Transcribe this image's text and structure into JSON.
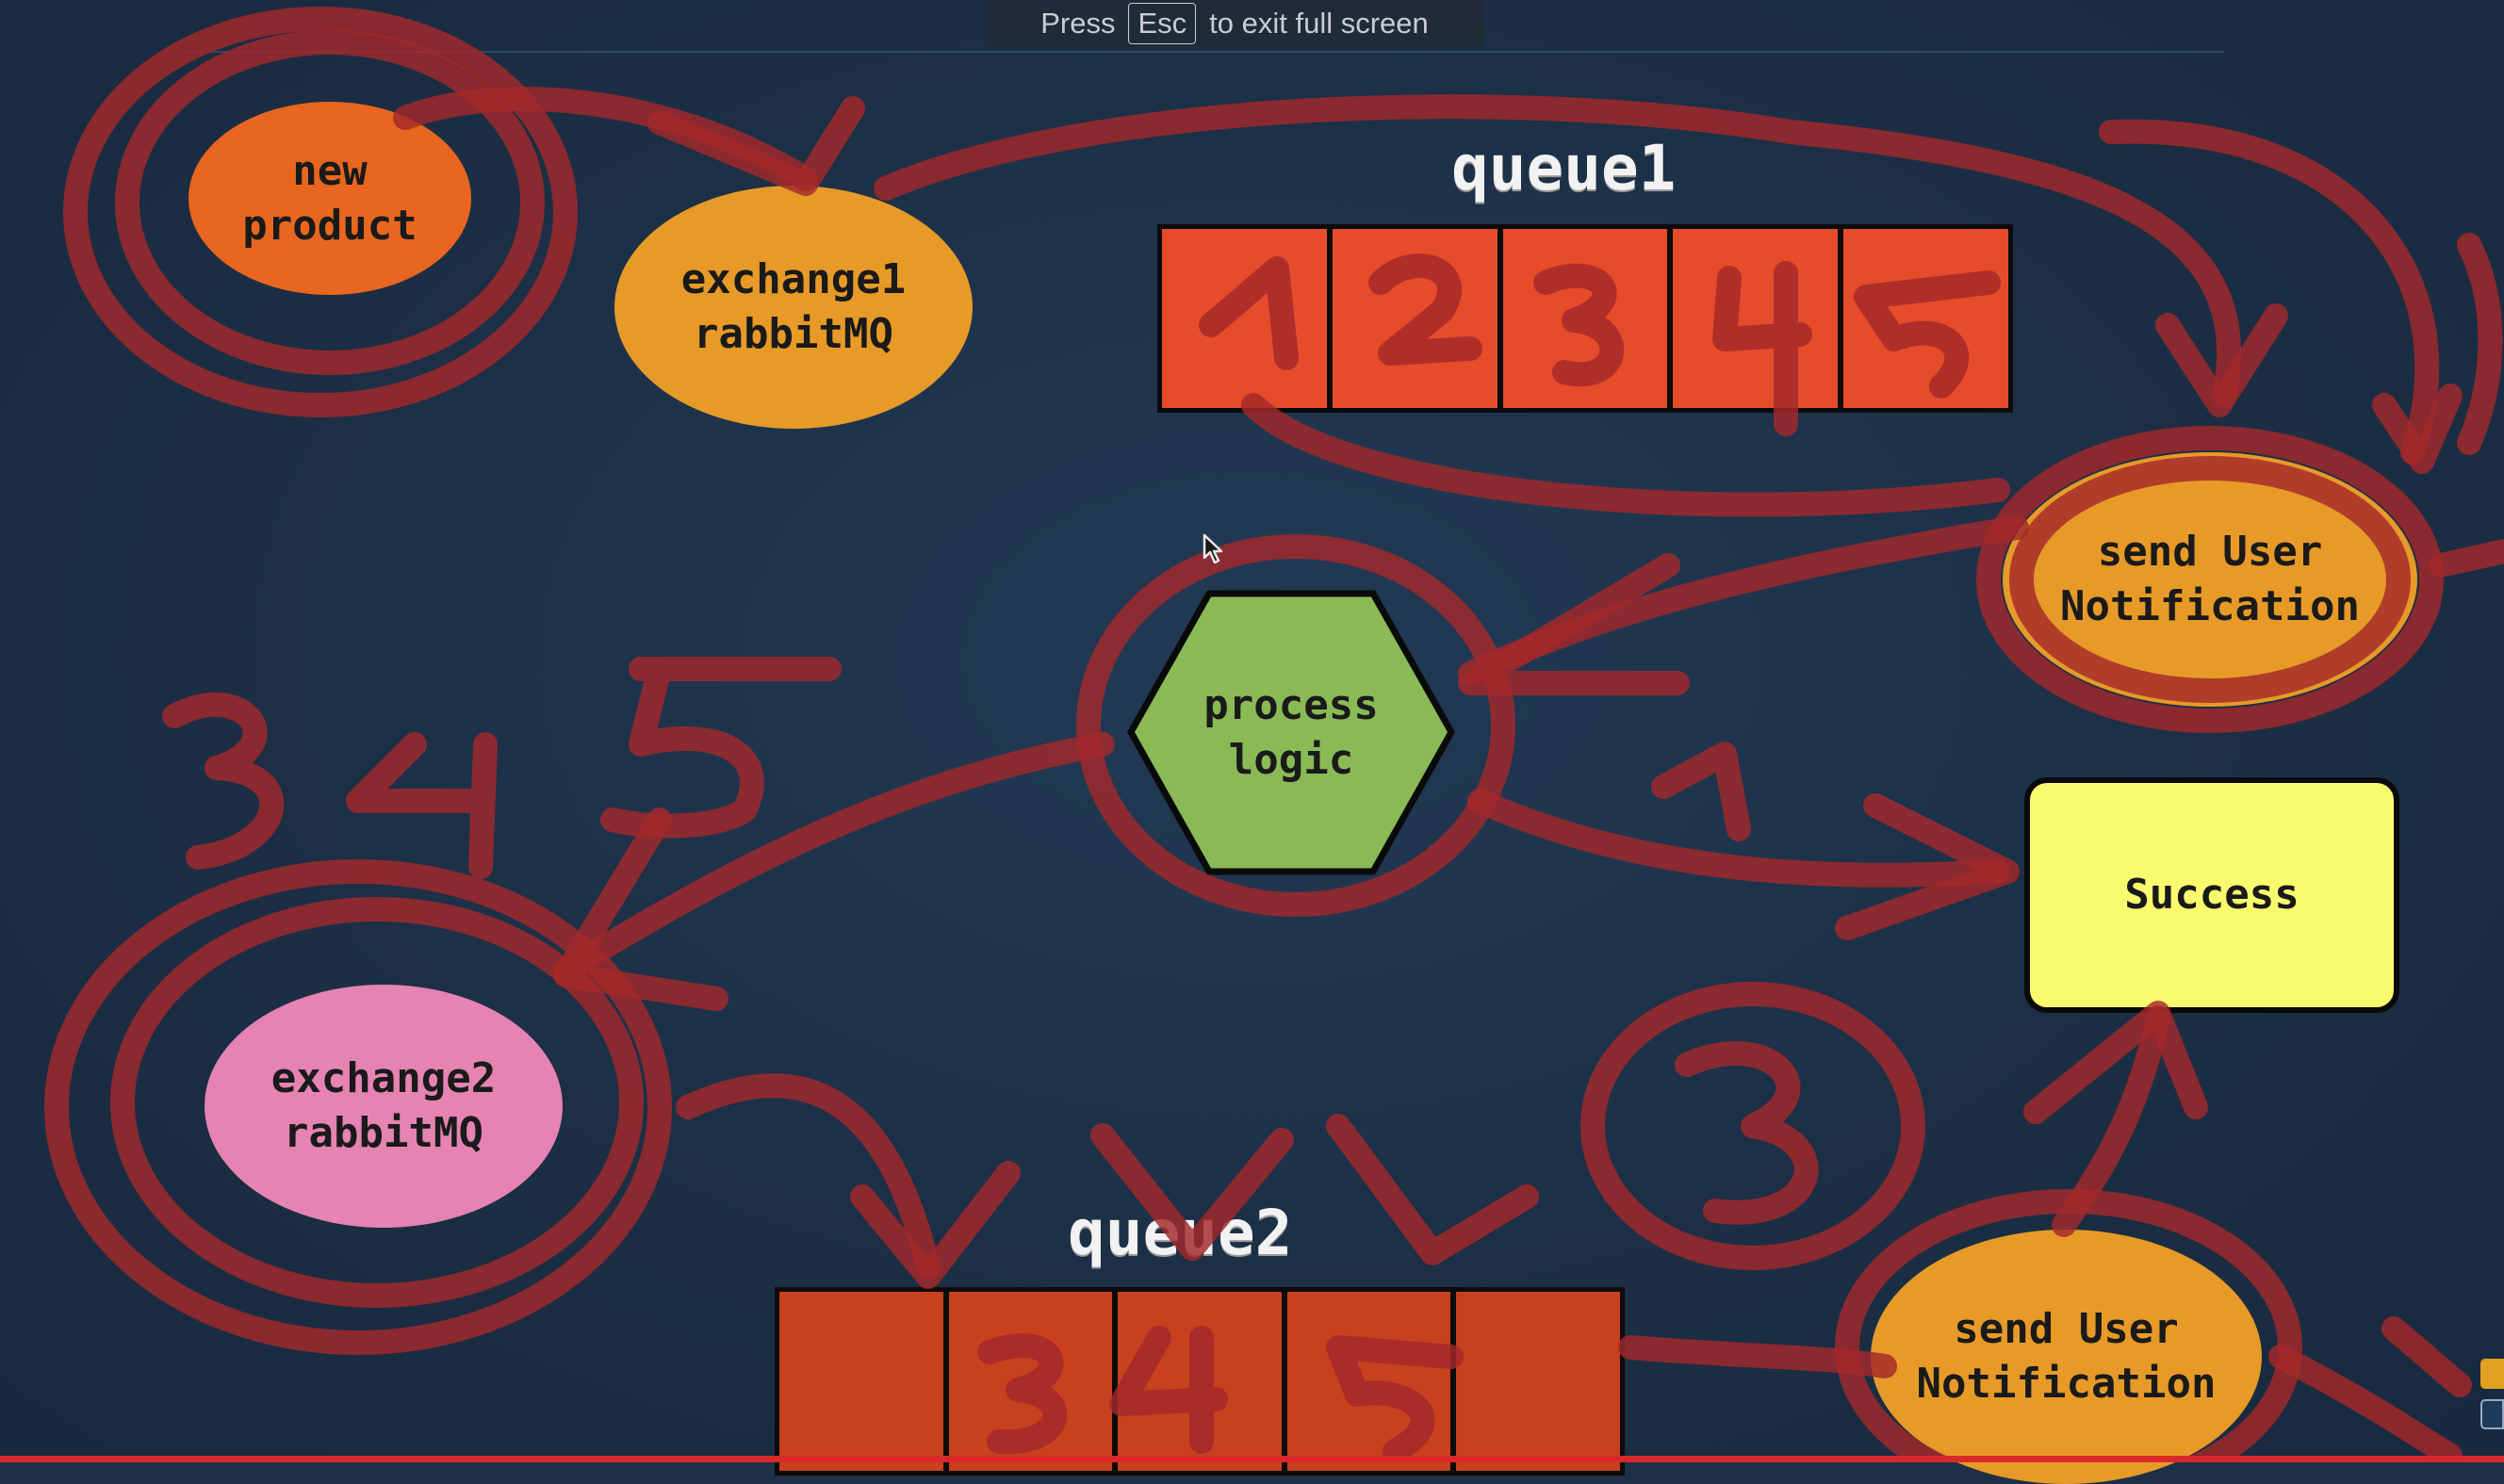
{
  "banner": {
    "prefix": "Press",
    "key": "Esc",
    "suffix": "to exit full screen"
  },
  "breadcrumb": "",
  "nodes": {
    "new_product": "new\nproduct",
    "exchange1": "exchange1\nrabbitMQ",
    "process": "process\nlogic",
    "notify1": "send User\nNotification",
    "success": "Success",
    "exchange2": "exchange2\nrabbitMQ",
    "notify2": "send User\nNotification"
  },
  "queues": {
    "queue1": "queue1",
    "queue2": "queue2"
  },
  "annotations": {
    "queue1_numbers": [
      "1",
      "2",
      "3",
      "4",
      "5"
    ],
    "queue2_numbers": [
      "3",
      "4",
      "5"
    ],
    "left_numbers": [
      "3",
      "4",
      "5"
    ],
    "circled_number": "3",
    "arrow_number": "1"
  },
  "colors": {
    "background": "#1d3047",
    "ink": "#a3282b",
    "orange": "#e8661f",
    "amber": "#e79a28",
    "pink": "#e583b2",
    "green": "#8aba56",
    "yellow": "#fafa6f",
    "queue_red": "#e64c2a"
  }
}
